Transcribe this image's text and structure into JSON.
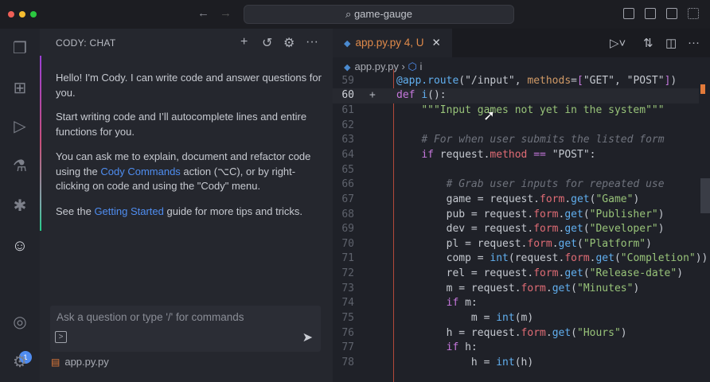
{
  "titlebar": {
    "search": "game-gauge",
    "back_icon": "arrow-left-icon",
    "forward_icon": "arrow-right-icon"
  },
  "activity": {
    "badge": "1"
  },
  "chat": {
    "title": "CODY: CHAT",
    "messages": [
      {
        "text": "Hello! I'm Cody. I can write code and answer questions for you."
      },
      {
        "text": "Start writing code and I’ll autocomplete lines and entire functions for you."
      },
      {
        "before": "You can ask me to explain, document and refactor code using the ",
        "link": "Cody Commands",
        "after": " action (⌥C), or by right-clicking on code and using the \"Cody\" menu."
      },
      {
        "before": "See the ",
        "link": "Getting Started",
        "after": " guide for more tips and tricks."
      }
    ],
    "input_placeholder": "Ask a question or type '/' for commands",
    "context_file": "app.py.py"
  },
  "editor": {
    "tab": {
      "name": "app.py.py",
      "status": "4, U"
    },
    "breadcrumb": {
      "file": "app.py.py",
      "symbol": "i"
    },
    "lines": [
      {
        "n": "58",
        "t": [
          [
            "",
            ""
          ]
        ]
      },
      {
        "n": "59",
        "t": [
          [
            "@app.",
            "d"
          ],
          [
            "route",
            "f"
          ],
          [
            "(\"/input\", ",
            ""
          ],
          [
            "methods",
            "o"
          ],
          [
            "=",
            ""
          ],
          [
            "[",
            "b"
          ],
          [
            "\"GET\", \"POST\"",
            ""
          ],
          [
            "]",
            "b"
          ],
          [
            ")",
            ""
          ]
        ]
      },
      {
        "n": "60",
        "t": [
          [
            "def ",
            "k"
          ],
          [
            "i",
            "f"
          ],
          [
            "():",
            ""
          ]
        ]
      },
      {
        "n": "61",
        "t": [
          [
            "    ",
            ""
          ],
          [
            "\"\"\"Input games not yet in the system\"\"\"",
            "s"
          ]
        ]
      },
      {
        "n": "62",
        "t": [
          [
            "",
            ""
          ]
        ]
      },
      {
        "n": "63",
        "t": [
          [
            "    ",
            ""
          ],
          [
            "# For when user submits the listed form",
            "c"
          ]
        ]
      },
      {
        "n": "64",
        "t": [
          [
            "    ",
            ""
          ],
          [
            "if ",
            "k"
          ],
          [
            "request.",
            ""
          ],
          [
            "method",
            "p"
          ],
          [
            " ",
            ""
          ],
          [
            "==",
            "k"
          ],
          [
            " \"POST\":",
            ""
          ]
        ]
      },
      {
        "n": "65",
        "t": [
          [
            "",
            ""
          ]
        ]
      },
      {
        "n": "66",
        "t": [
          [
            "        ",
            ""
          ],
          [
            "# Grab user inputs for repeated use",
            "c"
          ]
        ]
      },
      {
        "n": "67",
        "t": [
          [
            "        game = request.",
            ""
          ],
          [
            "form",
            "p"
          ],
          [
            ".",
            ""
          ],
          [
            "get",
            "f"
          ],
          [
            "(",
            ""
          ],
          [
            "\"Game\"",
            "s"
          ],
          [
            ")",
            ""
          ]
        ]
      },
      {
        "n": "68",
        "t": [
          [
            "        pub = request.",
            ""
          ],
          [
            "form",
            "p"
          ],
          [
            ".",
            ""
          ],
          [
            "get",
            "f"
          ],
          [
            "(",
            ""
          ],
          [
            "\"Publisher\"",
            "s"
          ],
          [
            ")",
            ""
          ]
        ]
      },
      {
        "n": "69",
        "t": [
          [
            "        dev = request.",
            ""
          ],
          [
            "form",
            "p"
          ],
          [
            ".",
            ""
          ],
          [
            "get",
            "f"
          ],
          [
            "(",
            ""
          ],
          [
            "\"Developer\"",
            "s"
          ],
          [
            ")",
            ""
          ]
        ]
      },
      {
        "n": "70",
        "t": [
          [
            "        pl = request.",
            ""
          ],
          [
            "form",
            "p"
          ],
          [
            ".",
            ""
          ],
          [
            "get",
            "f"
          ],
          [
            "(",
            ""
          ],
          [
            "\"Platform\"",
            "s"
          ],
          [
            ")",
            ""
          ]
        ]
      },
      {
        "n": "71",
        "t": [
          [
            "        comp = ",
            ""
          ],
          [
            "int",
            "f"
          ],
          [
            "(request.",
            ""
          ],
          [
            "form",
            "p"
          ],
          [
            ".",
            ""
          ],
          [
            "get",
            "f"
          ],
          [
            "(",
            ""
          ],
          [
            "\"Completion\"",
            "s"
          ],
          [
            "))",
            ""
          ]
        ]
      },
      {
        "n": "72",
        "t": [
          [
            "        rel = request.",
            ""
          ],
          [
            "form",
            "p"
          ],
          [
            ".",
            ""
          ],
          [
            "get",
            "f"
          ],
          [
            "(",
            ""
          ],
          [
            "\"Release-date\"",
            "s"
          ],
          [
            ")",
            ""
          ]
        ]
      },
      {
        "n": "73",
        "t": [
          [
            "        m = request.",
            ""
          ],
          [
            "form",
            "p"
          ],
          [
            ".",
            ""
          ],
          [
            "get",
            "f"
          ],
          [
            "(",
            ""
          ],
          [
            "\"Minutes\"",
            "s"
          ],
          [
            ")",
            ""
          ]
        ]
      },
      {
        "n": "74",
        "t": [
          [
            "        ",
            ""
          ],
          [
            "if ",
            "k"
          ],
          [
            "m:",
            ""
          ]
        ]
      },
      {
        "n": "75",
        "t": [
          [
            "            m = ",
            ""
          ],
          [
            "int",
            "f"
          ],
          [
            "(m)",
            ""
          ]
        ]
      },
      {
        "n": "76",
        "t": [
          [
            "        h = request.",
            ""
          ],
          [
            "form",
            "p"
          ],
          [
            ".",
            ""
          ],
          [
            "get",
            "f"
          ],
          [
            "(",
            ""
          ],
          [
            "\"Hours\"",
            "s"
          ],
          [
            ")",
            ""
          ]
        ]
      },
      {
        "n": "77",
        "t": [
          [
            "        ",
            ""
          ],
          [
            "if ",
            "k"
          ],
          [
            "h:",
            ""
          ]
        ]
      },
      {
        "n": "78",
        "t": [
          [
            "            h = ",
            ""
          ],
          [
            "int",
            "f"
          ],
          [
            "(h)",
            ""
          ]
        ]
      }
    ],
    "active_line": "60"
  },
  "colors": {
    "accent": "#4f8df0",
    "modified": "#e08a4a",
    "badge": "#4f8cf0"
  }
}
